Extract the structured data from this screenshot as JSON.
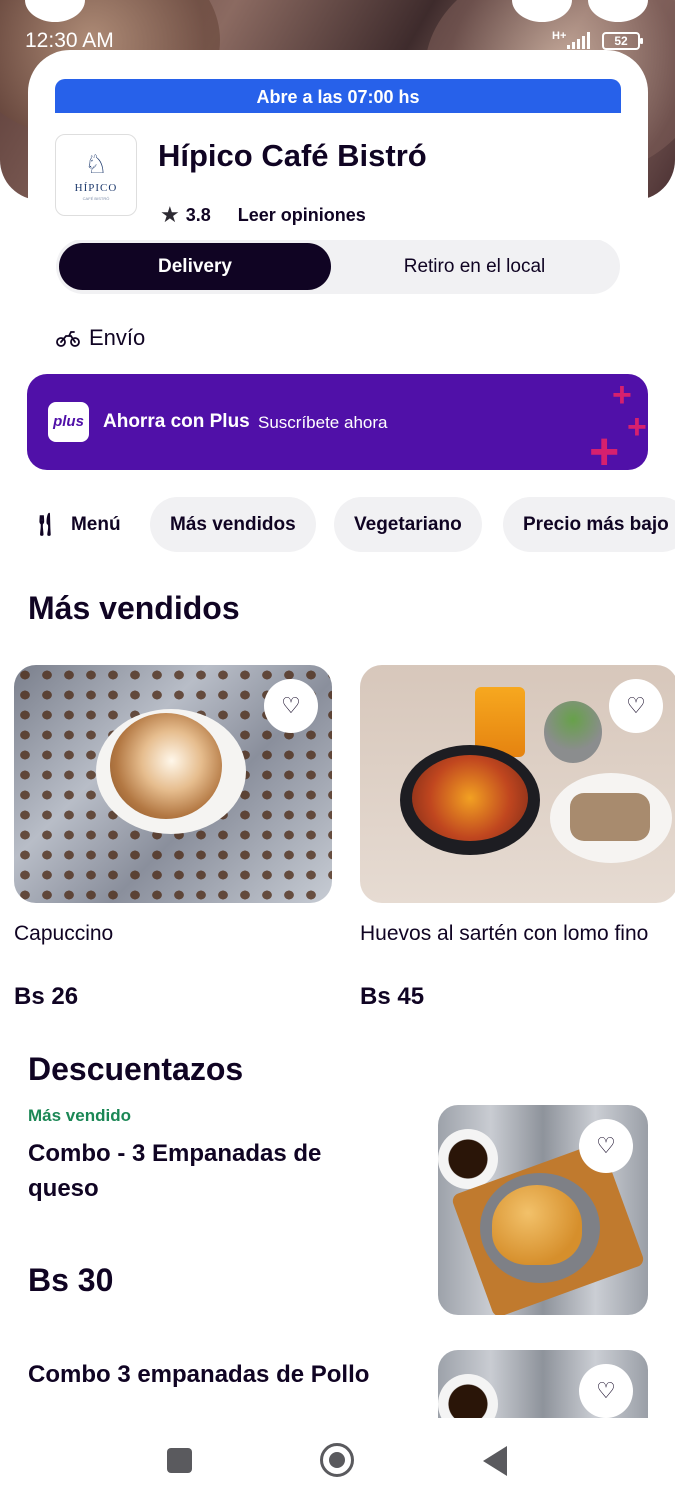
{
  "status_bar": {
    "time": "12:30 AM",
    "network": "H+",
    "battery": "52"
  },
  "store": {
    "open_banner": "Abre a las 07:00 hs",
    "logo_text": "HÍPICO",
    "logo_subtext": "CAFÉ BISTRÓ",
    "name": "Hípico Café Bistró",
    "rating": "3.8",
    "reviews_link": "Leer opiniones"
  },
  "delivery_toggle": {
    "active": "Delivery",
    "inactive": "Retiro en el local"
  },
  "shipping": {
    "label": "Envío",
    "icon": "motorcycle-icon"
  },
  "plus_banner": {
    "badge": "plus",
    "title": "Ahorra con Plus",
    "cta": "Suscríbete ahora"
  },
  "menu_chips": {
    "menu_label": "Menú",
    "chips": [
      "Más vendidos",
      "Vegetariano",
      "Precio más bajo"
    ]
  },
  "best_sellers": {
    "title": "Más vendidos",
    "products": [
      {
        "name": "Capuccino",
        "price": "Bs 26"
      },
      {
        "name": "Huevos al sartén con lomo fino",
        "price": "Bs 45"
      }
    ]
  },
  "discounts": {
    "title": "Descuentazos",
    "items": [
      {
        "tag": "Más vendido",
        "name": "Combo - 3 Empanadas de queso",
        "price": "Bs 30"
      },
      {
        "tag": "",
        "name": "Combo 3 empanadas de Pollo",
        "price": ""
      }
    ]
  },
  "colors": {
    "primary_dark": "#100423",
    "open_banner_blue": "#2761ea",
    "plus_purple": "#5010a8",
    "best_seller_green": "#1b8755",
    "plus_accent_pink": "#d6206e"
  }
}
